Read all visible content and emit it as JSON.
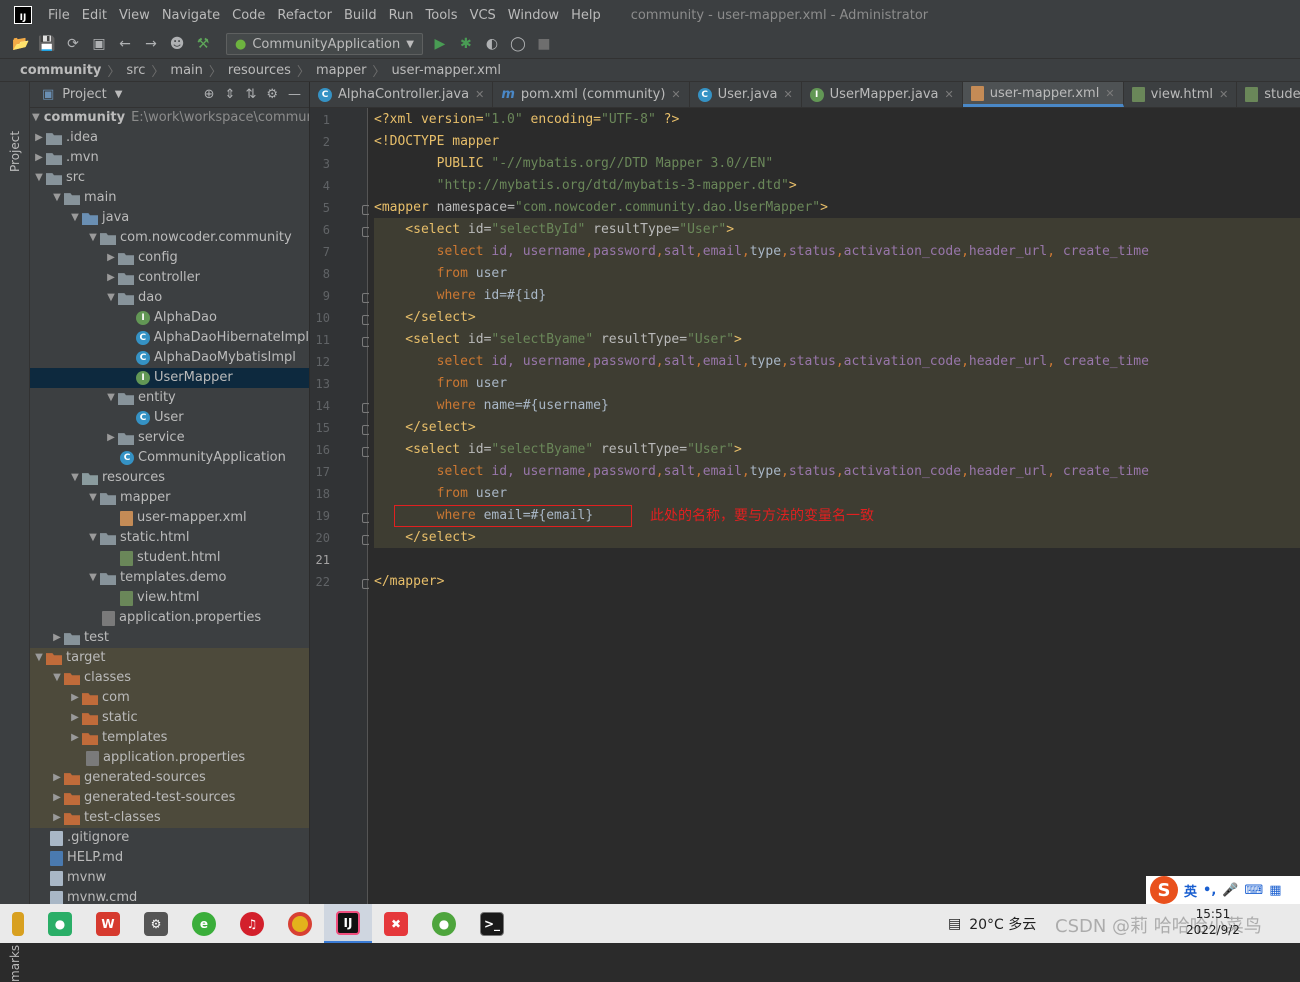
{
  "app": {
    "logo": "IJ",
    "menu": [
      "File",
      "Edit",
      "View",
      "Navigate",
      "Code",
      "Refactor",
      "Build",
      "Run",
      "Tools",
      "VCS",
      "Window",
      "Help"
    ],
    "window_title": "community - user-mapper.xml - Administrator"
  },
  "toolbar": {
    "run_config": "CommunityApplication"
  },
  "breadcrumb": [
    "community",
    "src",
    "main",
    "resources",
    "mapper",
    "user-mapper.xml"
  ],
  "project_panel": {
    "title": "Project",
    "stripe_label": "Project",
    "stripe_label_bottom": "marks"
  },
  "tree": [
    {
      "label": "community",
      "extra": "E:\\work\\workspace\\community",
      "bold": true
    },
    {
      "label": ".idea"
    },
    {
      "label": ".mvn"
    },
    {
      "label": "src"
    },
    {
      "label": "main"
    },
    {
      "label": "java"
    },
    {
      "label": "com.nowcoder.community"
    },
    {
      "label": "config"
    },
    {
      "label": "controller"
    },
    {
      "label": "dao"
    },
    {
      "label": "AlphaDao"
    },
    {
      "label": "AlphaDaoHibernateImpl"
    },
    {
      "label": "AlphaDaoMybatisImpl"
    },
    {
      "label": "UserMapper"
    },
    {
      "label": "entity"
    },
    {
      "label": "User"
    },
    {
      "label": "service"
    },
    {
      "label": "CommunityApplication"
    },
    {
      "label": "resources"
    },
    {
      "label": "mapper"
    },
    {
      "label": "user-mapper.xml"
    },
    {
      "label": "static.html"
    },
    {
      "label": "student.html"
    },
    {
      "label": "templates.demo"
    },
    {
      "label": "view.html"
    },
    {
      "label": "application.properties"
    },
    {
      "label": "test"
    },
    {
      "label": "target"
    },
    {
      "label": "classes"
    },
    {
      "label": "com"
    },
    {
      "label": "static"
    },
    {
      "label": "templates"
    },
    {
      "label": "application.properties"
    },
    {
      "label": "generated-sources"
    },
    {
      "label": "generated-test-sources"
    },
    {
      "label": "test-classes"
    },
    {
      "label": ".gitignore"
    },
    {
      "label": "HELP.md"
    },
    {
      "label": "mvnw"
    },
    {
      "label": "mvnw.cmd"
    }
  ],
  "tabs": [
    {
      "label": "AlphaController.java",
      "icon": "C"
    },
    {
      "label": "pom.xml (community)",
      "icon": "m"
    },
    {
      "label": "User.java",
      "icon": "C"
    },
    {
      "label": "UserMapper.java",
      "icon": "I"
    },
    {
      "label": "user-mapper.xml",
      "icon": "xml",
      "active": true
    },
    {
      "label": "view.html",
      "icon": "H"
    },
    {
      "label": "student.html",
      "icon": "H"
    }
  ],
  "line_numbers": [
    "1",
    "2",
    "3",
    "4",
    "5",
    "6",
    "7",
    "8",
    "9",
    "10",
    "11",
    "12",
    "13",
    "14",
    "15",
    "16",
    "17",
    "18",
    "19",
    "20",
    "21",
    "22"
  ],
  "code": {
    "l1": [
      "<?xml version=",
      "\"1.0\"",
      " encoding=",
      "\"UTF-8\"",
      " ?>"
    ],
    "l2": [
      "<!DOCTYPE mapper"
    ],
    "l3": [
      "        PUBLIC ",
      "\"-//mybatis.org//DTD Mapper 3.0//EN\""
    ],
    "l4": [
      "        ",
      "\"http://mybatis.org/dtd/mybatis-3-mapper.dtd\"",
      ">"
    ],
    "l5": [
      "<mapper",
      " namespace=",
      "\"com.nowcoder.community.dao.UserMapper\"",
      ">"
    ],
    "select_open_1": [
      "    <select",
      " id=",
      "\"selectById\"",
      " resultType=",
      "\"User\"",
      ">"
    ],
    "select_cols": [
      "        select ",
      "id, ",
      "username",
      ",",
      "password",
      ",",
      "salt",
      ",",
      "email",
      ",",
      "type",
      ",",
      "status",
      ",",
      "activation_code",
      ",",
      "header_url",
      ", ",
      "create_time"
    ],
    "from_kw": "        from ",
    "from_tbl": "user",
    "where_kw": "        where ",
    "where_1": "id=#{id}",
    "select_close": "    </select>",
    "select_open_2": [
      "    <select",
      " id=",
      "\"selectByame\"",
      " resultType=",
      "\"User\"",
      ">"
    ],
    "where_2": "name=#{username}",
    "where_3": "email=#{email}",
    "mapper_close": "</mapper>"
  },
  "annotation": "此处的名称，要与方法的变量名一致",
  "ime": {
    "lang": "英",
    "punct": "•,"
  },
  "tray": {
    "weather": "20°C  多云",
    "time": "15:51",
    "date": "2022/9/2",
    "watermark": "CSDN @莉 哈哈哈小菜鸟"
  }
}
